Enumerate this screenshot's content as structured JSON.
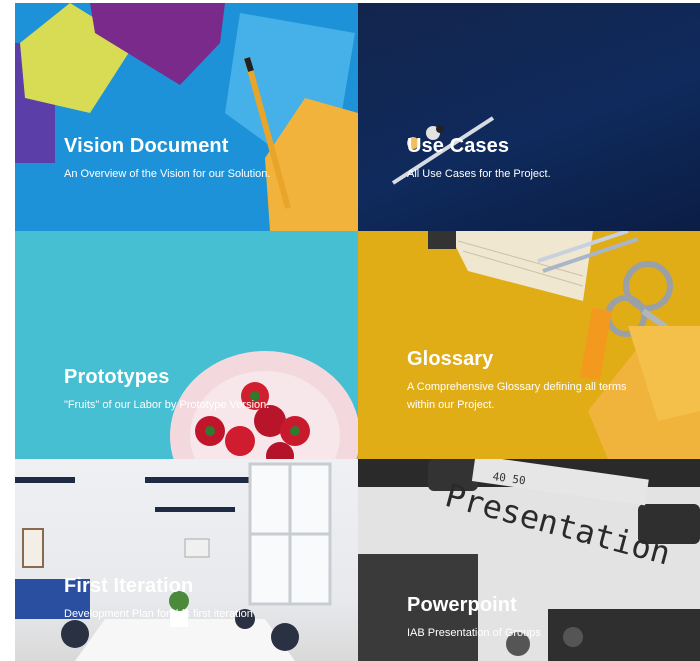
{
  "tiles": [
    {
      "title": "Vision Document",
      "subtitle": "An Overview of the Vision for our Solution."
    },
    {
      "title": "Use Cases",
      "subtitle": "All Use Cases for the Project."
    },
    {
      "title": "Prototypes",
      "subtitle": "\"Fruits\" of our Labor by Prototype Version."
    },
    {
      "title": "Glossary",
      "subtitle": "A Comprehensive Glossary defining all terms within our Project."
    },
    {
      "title": "First Iteration",
      "subtitle": "Development Plan for this first iteration"
    },
    {
      "title": "Powerpoint",
      "subtitle": "IAB Presentation of Groups"
    }
  ],
  "photo_text": {
    "typewriter_word": "Presentation",
    "ruler_marks": "40   50"
  }
}
